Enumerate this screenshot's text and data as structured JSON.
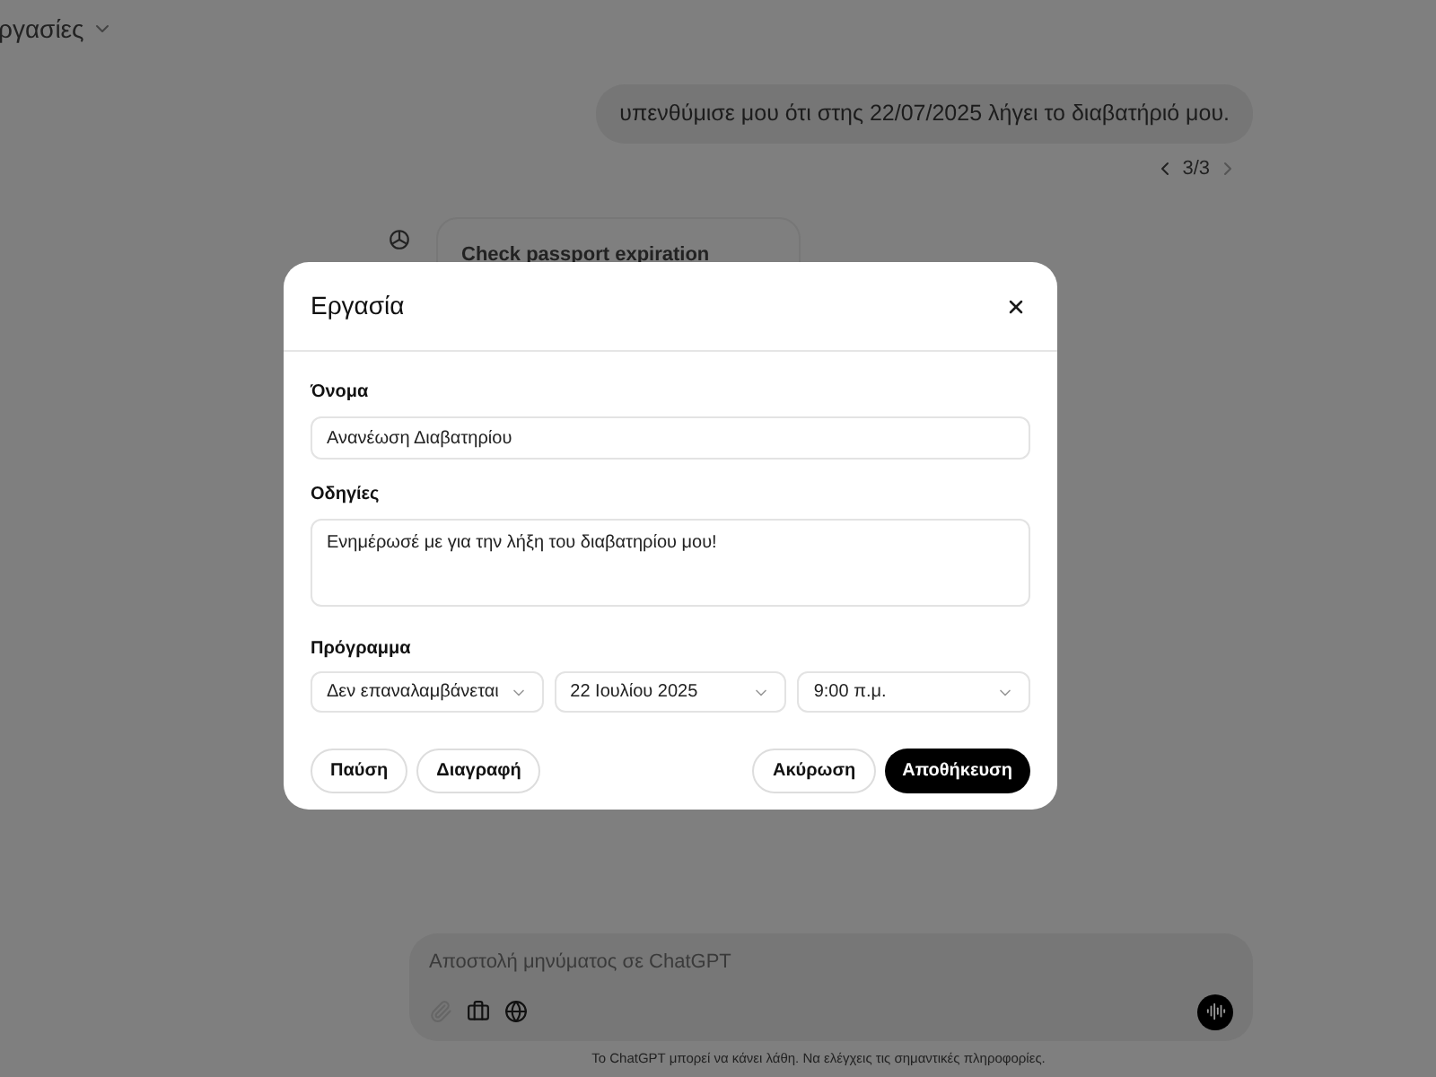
{
  "header": {
    "title": "ργασίες"
  },
  "user_message": {
    "text": "υπενθύμισε μου ότι στης 22/07/2025 λήγει το διαβατήριό μου.",
    "pager": "3/3"
  },
  "assistant_card": {
    "title": "Check passport expiration"
  },
  "dialog": {
    "title": "Εργασία",
    "name_label": "Όνομα",
    "name_value": "Ανανέωση Διαβατηρίου",
    "instructions_label": "Οδηγίες",
    "instructions_value": "Ενημέρωσέ με για την λήξη του διαβατηρίου μου!",
    "schedule_label": "Πρόγραμμα",
    "schedule": [
      {
        "value": "Δεν επαναλαμβάνεται"
      },
      {
        "value": "22 Ιουλίου 2025"
      },
      {
        "value": "9:00 π.μ."
      }
    ],
    "buttons_left": [
      "Παύση",
      "Διαγραφή"
    ],
    "buttons_right": [
      {
        "label": "Ακύρωση",
        "kind": "secondary"
      },
      {
        "label": "Αποθήκευση",
        "kind": "primary"
      }
    ]
  },
  "composer": {
    "placeholder": "Αποστολή μηνύματος σε ChatGPT"
  },
  "footer": "Το ChatGPT μπορεί να κάνει λάθη. Να ελέγχεις τις σημαντικές πληροφορίες."
}
